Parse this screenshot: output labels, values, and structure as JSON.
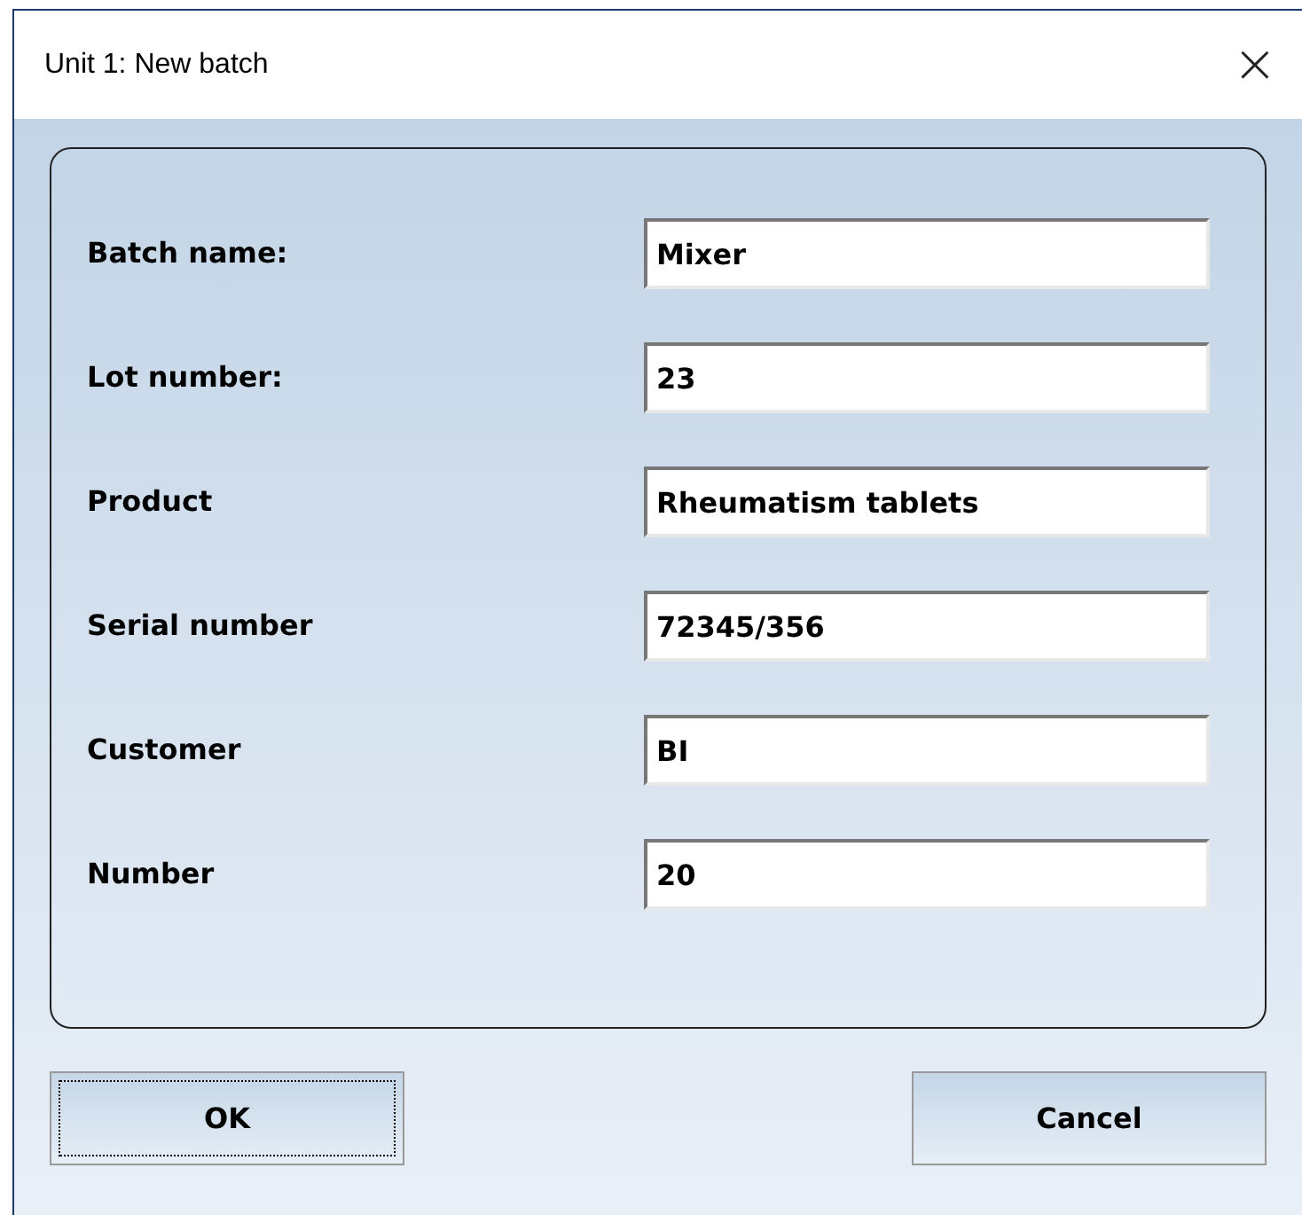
{
  "window": {
    "title": "Unit 1: New batch",
    "close": "×"
  },
  "fields": [
    {
      "label": "Batch name:",
      "value": "Mixer"
    },
    {
      "label": "Lot number:",
      "value": "23"
    },
    {
      "label": "Product",
      "value": "Rheumatism tablets"
    },
    {
      "label": "Serial number",
      "value": "72345/356"
    },
    {
      "label": "Customer",
      "value": "BI"
    },
    {
      "label": "Number",
      "value": "20"
    }
  ],
  "buttons": [
    {
      "label": "OK",
      "focused": true
    },
    {
      "label": "Cancel",
      "focused": false
    }
  ]
}
